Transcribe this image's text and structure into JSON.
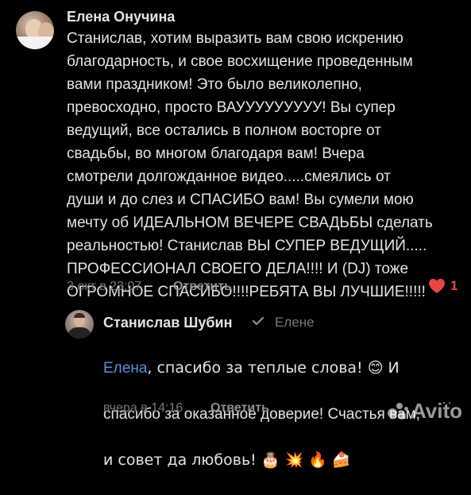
{
  "comment": {
    "author": "Елена Онучина",
    "text": "Станислав, хотим выразить вам свою искрению\nблагодарность, и свое восхищение проведенным\nвами  праздником! Это было великолепно,\nпревосходно, просто ВАУУУУУУУУУ! Вы супер\nведущий, все остались в полном восторге от\nсвадьбы, во многом благодаря вам! Вчера\nсмотрели долгожданное видео.....смеялись от\nдуши и до слез и СПАСИБО вам! Вы сумели мою\nмечту об ИДЕАЛЬНОМ ВЕЧЕРЕ СВАДЬБЫ сделать\nреальностью! Станислав ВЫ СУПЕР ВЕДУЩИЙ.....\nПРОФЕССИОНАЛ СВОЕГО ДЕЛА!!!! И (DJ) тоже\nОГРОМНОЕ СПАСИБО!!!!РЕБЯТА ВЫ ЛУЧШИЕ!!!!!",
    "timestamp": "3 окт в 23:07",
    "reply_label": "Ответить",
    "likes": "1",
    "like_color": "#e64646"
  },
  "reply": {
    "author": "Станислав Шубин",
    "verified_icon": "check-icon",
    "reply_to": "Елене",
    "mention": "Елена",
    "text_line1_rest": ", спасибо за теплые слова! 😊 И",
    "text_line2": "спасибо за оказанное доверие! Счастья вам,",
    "text_line3": "и совет да любовь! 🎂 💥 🔥 🍰",
    "timestamp": "вчера в 14:16",
    "reply_label": "Ответить",
    "more_label": "··"
  },
  "watermark": {
    "text": "Avito"
  },
  "colors": {
    "background": "#000000",
    "text": "#e1e3e6",
    "muted": "#76787a",
    "link": "#5b8fe0"
  }
}
